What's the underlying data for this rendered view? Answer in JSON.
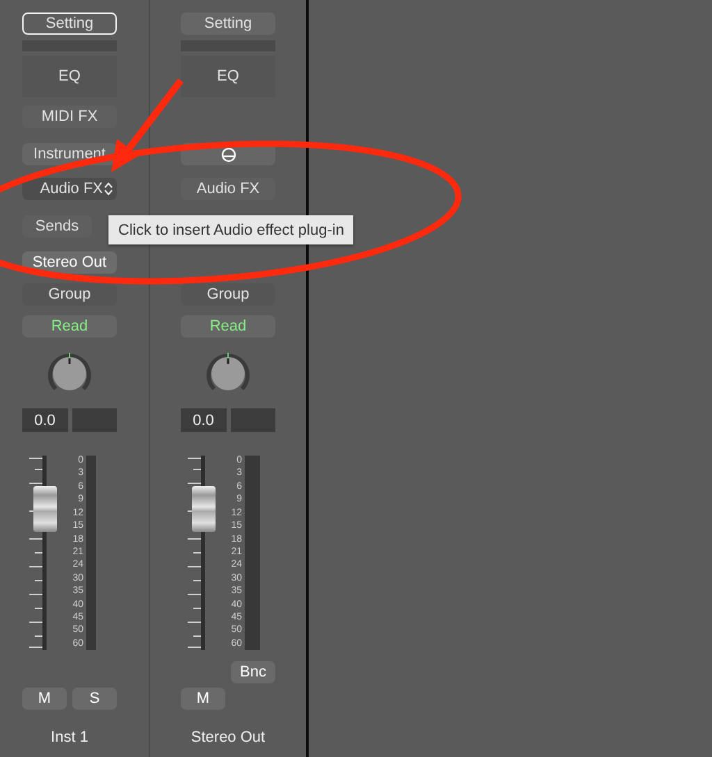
{
  "strips": [
    {
      "setting": {
        "label": "Setting",
        "focused": true
      },
      "eq": "EQ",
      "midi_fx": "MIDI FX",
      "instrument": {
        "kind": "text",
        "label": "Instrument"
      },
      "audio_fx": {
        "label": "Audio FX",
        "selected": true
      },
      "sends": "Sends",
      "output": "Stereo Out",
      "group": "Group",
      "automation": "Read",
      "volume": "0.0",
      "fader": {
        "level": 0.73
      },
      "meter_scale": [
        "0",
        "3",
        "6",
        "9",
        "12",
        "15",
        "18",
        "21",
        "24",
        "30",
        "35",
        "40",
        "45",
        "50",
        "60"
      ],
      "buttons": [
        "M",
        "S"
      ],
      "name": "Inst 1"
    },
    {
      "setting": {
        "label": "Setting",
        "focused": false
      },
      "eq": "EQ",
      "instrument": {
        "kind": "icon"
      },
      "audio_fx": {
        "label": "Audio FX",
        "selected": false
      },
      "group": "Group",
      "automation": "Read",
      "volume": "0.0",
      "fader": {
        "level": 0.73
      },
      "meter_scale": [
        "0",
        "3",
        "6",
        "9",
        "12",
        "15",
        "18",
        "21",
        "24",
        "30",
        "35",
        "40",
        "45",
        "50",
        "60"
      ],
      "bounce": "Bnc",
      "buttons": [
        "M"
      ],
      "name": "Stereo Out"
    }
  ],
  "tooltip": "Click to insert Audio effect plug-in"
}
